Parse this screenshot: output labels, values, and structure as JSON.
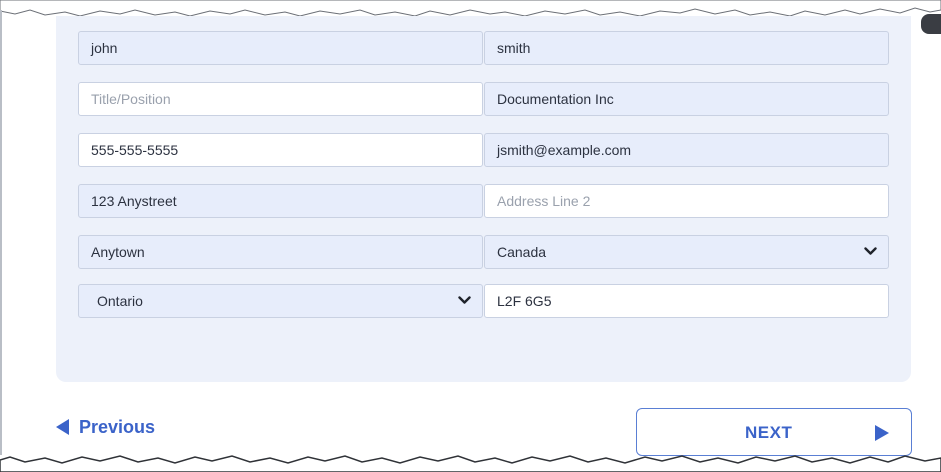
{
  "form": {
    "first_name": "john",
    "last_name": "smith",
    "title_placeholder": "Title/Position",
    "company": "Documentation Inc",
    "phone": "555-555-5555",
    "email": "jsmith@example.com",
    "address_line1": "123 Anystreet",
    "address_line2_placeholder": "Address Line 2",
    "city": "Anytown",
    "country_selected": "Canada",
    "province_selected": "Ontario",
    "postal_code": "L2F 6G5"
  },
  "nav": {
    "previous_label": "Previous",
    "next_label": "NEXT"
  },
  "colors": {
    "accent": "#3b63c9",
    "card_background": "#edf1fa",
    "filled_field": "#e7edfb"
  },
  "icons": {
    "previous": "triangle-left-icon",
    "next": "triangle-right-icon",
    "select": "chevron-down-icon"
  }
}
